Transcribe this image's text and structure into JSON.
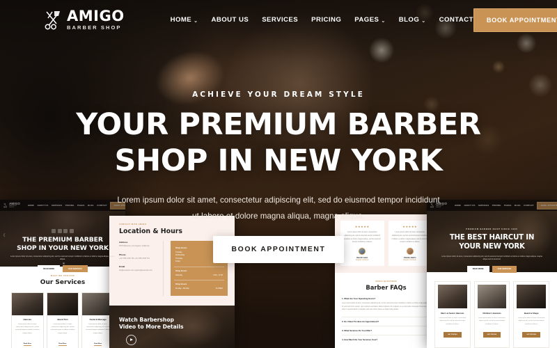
{
  "brand": {
    "name": "AMIGO",
    "tagline": "BARBER SHOP",
    "logo_icon": "razor-scissors-icon",
    "accent_color": "#c89355",
    "dark_color": "#140f0c"
  },
  "navbar": {
    "links": [
      {
        "label": "HOME",
        "has_dropdown": true
      },
      {
        "label": "ABOUT US",
        "has_dropdown": false
      },
      {
        "label": "SERVICES",
        "has_dropdown": false
      },
      {
        "label": "PRICING",
        "has_dropdown": false
      },
      {
        "label": "PAGES",
        "has_dropdown": true
      },
      {
        "label": "BLOG",
        "has_dropdown": true
      },
      {
        "label": "CONTACT",
        "has_dropdown": false
      }
    ],
    "cta_label": "BOOK APPOINTMENT",
    "caret_glyph": "⌄"
  },
  "hero": {
    "kicker": "ACHIEVE  YOUR  DREAM  STYLE",
    "title_line1": "YOUR PREMIUM BARBER",
    "title_line2": "SHOP IN NEW YORK",
    "description": "Lorem ipsum dolor sit amet, consectetur adipiscing elit, sed do eiusmod tempor incididunt ut labore et dolore magna aliqua, magna aliqua.",
    "cta_label": "BOOK APPOINTMENT"
  },
  "thumbnails": {
    "left": {
      "nav_links": [
        "HOME",
        "ABOUT US",
        "SERVICES",
        "PRICING",
        "PAGES",
        "BLOG",
        "CONTACT"
      ],
      "nav_cta": "BOOK APPOINTMENT",
      "hero_title_line1": "THE PREMIUM BARBER",
      "hero_title_line2": "SHOP IN YOUR NEW YORK",
      "hero_desc": "Lorem ipsum dolor sit amet, consectetur adipiscing elit, sed do eiusmod tempor incididunt ut labore et dolore magna aliqua, magna aliqua.",
      "btn_primary": "READ MORE",
      "btn_secondary": "OUR SERVICES",
      "services_eyebrow": "WHAT WE PROVIDE",
      "services_title": "Our Services",
      "service_cards": [
        {
          "title": "Haircuts",
          "text": "Lorem ipsum dolor sit amet, consectetur adipiscing elit, sed do eiusmod tempor incididunt ut labore magna aliqua.",
          "link": "Read More"
        },
        {
          "title": "Beard Trim",
          "text": "Lorem ipsum dolor sit amet, consectetur adipiscing elit, sed do eiusmod tempor incididunt ut labore magna aliqua.",
          "link": "Read More"
        },
        {
          "title": "Facial & Massage",
          "text": "Lorem ipsum dolor sit amet, consectetur adipiscing elit, sed do eiusmod tempor incididunt ut labore magna aliqua.",
          "link": "Read More"
        }
      ]
    },
    "middle": {
      "eyebrow": "CONTACT WITH AMIGO",
      "title": "Location & Hours",
      "info_blocks": [
        {
          "title": "Address",
          "lines": "4578 Marmora,\nLos Angeles, California"
        },
        {
          "title": "Phone",
          "lines": "+44 7365 4765 750\n+44 7365 4765 751"
        },
        {
          "title": "Email",
          "lines": "info@example.com\nsupport@example.com"
        }
      ],
      "hours_sections": [
        {
          "heading": "Shop Hours",
          "rows": [
            {
              "day": "Tuesday",
              "time": "8:00 - 17:00"
            },
            {
              "day": "Wednesday",
              "time": "8:00 - 17:00"
            },
            {
              "day": "Thursday",
              "time": "8:00 - 17:00"
            },
            {
              "day": "Friday",
              "time": "8:00 - 17:00"
            }
          ]
        },
        {
          "heading": "Shop Hours",
          "rows": [
            {
              "day": "Saturday",
              "time": "8:00 - 17:00"
            }
          ]
        },
        {
          "heading": "Shop Hours",
          "rows": [
            {
              "day": "Sunday - Monday",
              "time": "CLOSED"
            }
          ]
        }
      ],
      "video_title_line1": "Watch Barbershop",
      "video_title_line2": "Video to More Details",
      "play_icon": "play-circle-icon"
    },
    "right": {
      "testimonials": [
        {
          "stars": "★★★★★",
          "quote": "Lorem ipsum dolor sit amet, consectetur adipiscing elit, sed do eiusmod tempor incididunt ut labore et dolore magna aliqua, sed do eiusmod tempor incididunt ut labore.",
          "name": "Harold Lewis",
          "role": "Regular Customer",
          "avatar": "avatar-icon"
        },
        {
          "stars": "★★★★★",
          "quote": "Lorem ipsum dolor sit amet, consectetur adipiscing elit, sed do eiusmod tempor incididunt ut labore et dolore magna aliqua, sed do eiusmod tempor incididunt ut labore.",
          "name": "Charles Harris",
          "role": "Regular Customer",
          "avatar": "avatar-icon"
        }
      ],
      "faq_eyebrow": "AMIGO QUESTIONS",
      "faq_title": "Barber FAQs",
      "faq_open_question": "1. What Are Your Operating Hours?",
      "faq_open_answer": "Lorem ipsum dolor sit amet, consectetur adipiscing elit, sed do eiusmod tempor incididunt ut labore et dolore magna aliqua. Ut enim ad minim veniam, quis nostrud exercitation ullamco laboris nisi ut aliquip ex ea commodo consequat. Duis aute irure dolor in reprehenderit in voluptate velit esse cillum dolore eu fugiat nulla pariatur.",
      "faq_questions": [
        "2. Do I Need To Have An Appointment?",
        "3. What Services Do You Offer?",
        "4. How Much Do Your Services Cost?"
      ]
    },
    "far_right": {
      "nav_links": [
        "HOME",
        "ABOUT US",
        "SERVICES",
        "PRICING",
        "PAGES",
        "BLOG",
        "CONTACT"
      ],
      "nav_cta": "BOOK APPOINTMENT",
      "hero_kicker": "PREMIUM BARBER SHOP SINCE 1995",
      "hero_title_line1": "THE BEST HAIRCUT IN",
      "hero_title_line2": "YOUR NEW YORK",
      "hero_desc": "Lorem ipsum dolor sit amet, consectetur adipiscing elit, sed do eiusmod tempor incididunt ut labore et dolore magna aliqua, magna aliqua sed do eiusmod.",
      "btn_primary": "READ MORE",
      "btn_secondary": "OUR SERVICES",
      "cards": [
        {
          "title": "Men's & Senior Haircuts",
          "text": "Lorem ipsum dolor sit amet, consectetur adipiscing elit, sed do eiusmod tempor incididunt ut labore.",
          "button": "GET PRICING"
        },
        {
          "title": "Children's Haircuts",
          "text": "Lorem ipsum dolor sit amet, consectetur adipiscing elit, sed do eiusmod tempor incididunt ut labore.",
          "button": "GET PRICING"
        },
        {
          "title": "Beard & Shape",
          "text": "Lorem ipsum dolor sit amet, consectetur adipiscing elit, sed do eiusmod tempor incididunt ut labore.",
          "button": "GET PRICING"
        }
      ]
    }
  }
}
